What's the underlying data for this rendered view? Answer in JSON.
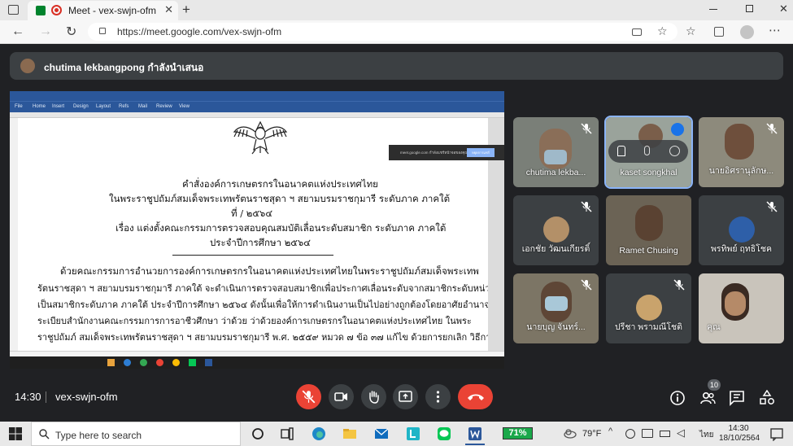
{
  "browser": {
    "tab_title": "Meet - vex-swjn-ofm",
    "tab_close": "✕",
    "new_tab": "+",
    "url": "https://meet.google.com/vex-swjn-ofm"
  },
  "presenter_bar": {
    "text": "chutima lekbangpong กำลังนำเสนอ"
  },
  "shared_document": {
    "line1": "คำสั่งองค์การเกษตรกรในอนาคตแห่งประเทศไทย",
    "line2": "ในพระราชูปถัมภ์สมเด็จพระเทพรัตนราชสุดา ฯ สยามบรมราชกุมารี ระดับภาค ภาคใต้",
    "line3": "ที่      / ๒๕๖๔",
    "line4": "เรื่อง  แต่งตั้งคณะกรรมการตรวจสอบคุณสมบัติเลื่อนระดับสมาชิก ระดับภาค ภาคใต้",
    "line5": "ประจำปีการศึกษา ๒๕๖๔",
    "para1": "ด้วยคณะกรรมการอำนวยการองค์การเกษตรกรในอนาคตแห่งประเทศไทยในพระราชูปถัมภ์สมเด็จพระเทพ",
    "para2": "รัตนราชสุดา ฯ สยามบรมราชกุมารี  ภาคใต้  จะดำเนินการตรวจสอบสมาชิกเพื่อประกาศเลื่อนระดับจากสมาชิกระดับหน่วย",
    "para3": "เป็นสมาชิกระดับภาค ภาคใต้ ประจำปีการศึกษา ๒๕๖๔ ดังนั้นเพื่อให้การดำเนินงานเป็นไปอย่างถูกต้องโดยอาศัยอำนาจตาม",
    "para4": "ระเบียบสำนักงานคณะกรรมการการอาชีวศึกษา    ว่าด้วย    ว่าด้วยองค์การเกษตรกรในอนาคตแห่งประเทศไทย    ในพระ",
    "para5": "ราชูปถัมภ์ สมเด็จพระเทพรัตนราชสุดา ฯ สยามบรมราชกุมารี พ.ศ. ๒๕๕๙ หมวด ๗ ข้อ ๓๗ แก้ไข ด้วยการยกเลิก วิธีการ",
    "notification": "meet.google.com กำลังแชร์หน้าจอของคุณ",
    "notification_button": "หยุดการแชร์"
  },
  "participants": [
    {
      "name": "chutima lekba...",
      "muted": true
    },
    {
      "name": "kaset songkhal",
      "muted": false,
      "speaking": true
    },
    {
      "name": "นายอิศรานุลักษ...",
      "muted": true
    },
    {
      "name": "เอกชัย วัฒนเกียรติ์",
      "muted": true
    },
    {
      "name": "Ramet Chusing",
      "muted": false
    },
    {
      "name": "พรทิพย์ ฤทธิโชค",
      "muted": true
    },
    {
      "name": "นายบุญ จันทร์...",
      "muted": true
    },
    {
      "name": "ปรีชา พรามณีโชติ",
      "muted": true
    },
    {
      "name": "คุณ",
      "muted": false
    }
  ],
  "meet_bottom": {
    "time": "14:30",
    "meeting_code": "vex-swjn-ofm",
    "people_count": "10"
  },
  "taskbar": {
    "search_placeholder": "Type here to search",
    "battery": "71%",
    "weather": "79°F",
    "language": "ไทย",
    "time": "14:30",
    "date": "18/10/2564"
  },
  "colors": {
    "meet_bg": "#202124",
    "tile_bg": "#3c4043",
    "leave_red": "#ea4335",
    "word_blue": "#2b579a",
    "speaking_blue": "#8ab4f8"
  }
}
